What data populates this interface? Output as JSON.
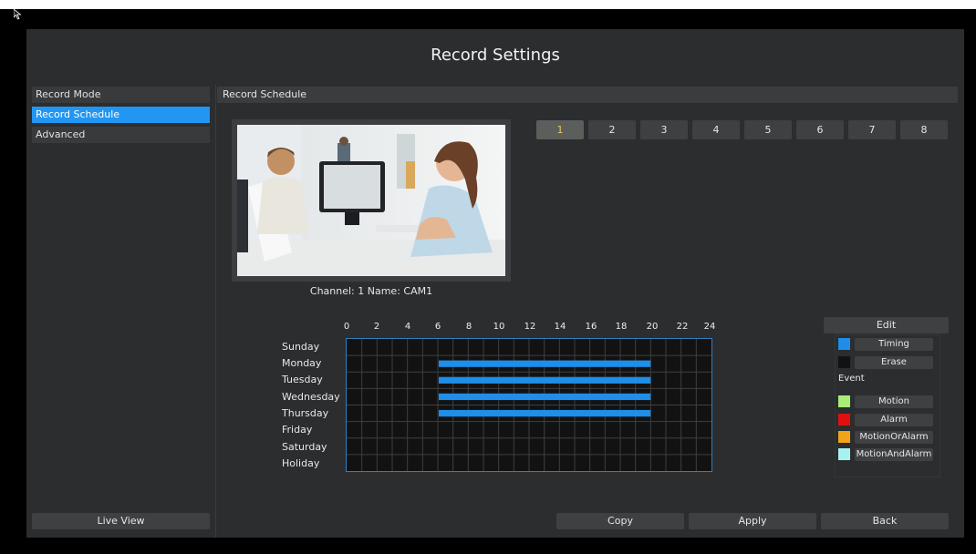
{
  "window": {
    "title": "Record Settings"
  },
  "sidebar": {
    "items": [
      {
        "label": "Record Mode",
        "active": false
      },
      {
        "label": "Record Schedule",
        "active": true
      },
      {
        "label": "Advanced",
        "active": false
      }
    ],
    "live_view_label": "Live View"
  },
  "main": {
    "section_title": "Record Schedule",
    "channel_info": "Channel: 1 Name: CAM1",
    "channels": [
      "1",
      "2",
      "3",
      "4",
      "5",
      "6",
      "7",
      "8"
    ],
    "selected_channel": "1"
  },
  "schedule": {
    "hours": [
      "0",
      "2",
      "4",
      "6",
      "8",
      "10",
      "12",
      "14",
      "16",
      "18",
      "20",
      "22",
      "24"
    ],
    "days": [
      {
        "name": "Sunday",
        "segments": []
      },
      {
        "name": "Monday",
        "segments": [
          {
            "start": 6,
            "end": 20,
            "type": "Timing"
          }
        ]
      },
      {
        "name": "Tuesday",
        "segments": [
          {
            "start": 6,
            "end": 20,
            "type": "Timing"
          }
        ]
      },
      {
        "name": "Wednesday",
        "segments": [
          {
            "start": 6,
            "end": 20,
            "type": "Timing"
          }
        ]
      },
      {
        "name": "Thursday",
        "segments": [
          {
            "start": 6,
            "end": 20,
            "type": "Timing"
          }
        ]
      },
      {
        "name": "Friday",
        "segments": []
      },
      {
        "name": "Saturday",
        "segments": []
      },
      {
        "name": "Holiday",
        "segments": []
      }
    ]
  },
  "legend": {
    "edit_label": "Edit",
    "timing": {
      "label": "Timing",
      "color": "#1e8ee8"
    },
    "erase": {
      "label": "Erase",
      "color": "#121212"
    },
    "event_label": "Event",
    "motion": {
      "label": "Motion",
      "color": "#a8ee78"
    },
    "alarm": {
      "label": "Alarm",
      "color": "#e01010"
    },
    "motion_or_alarm": {
      "label": "MotionOrAlarm",
      "color": "#f2a31a"
    },
    "motion_and_alarm": {
      "label": "MotionAndAlarm",
      "color": "#a6f2f0"
    }
  },
  "footer": {
    "copy_label": "Copy",
    "apply_label": "Apply",
    "back_label": "Back"
  }
}
